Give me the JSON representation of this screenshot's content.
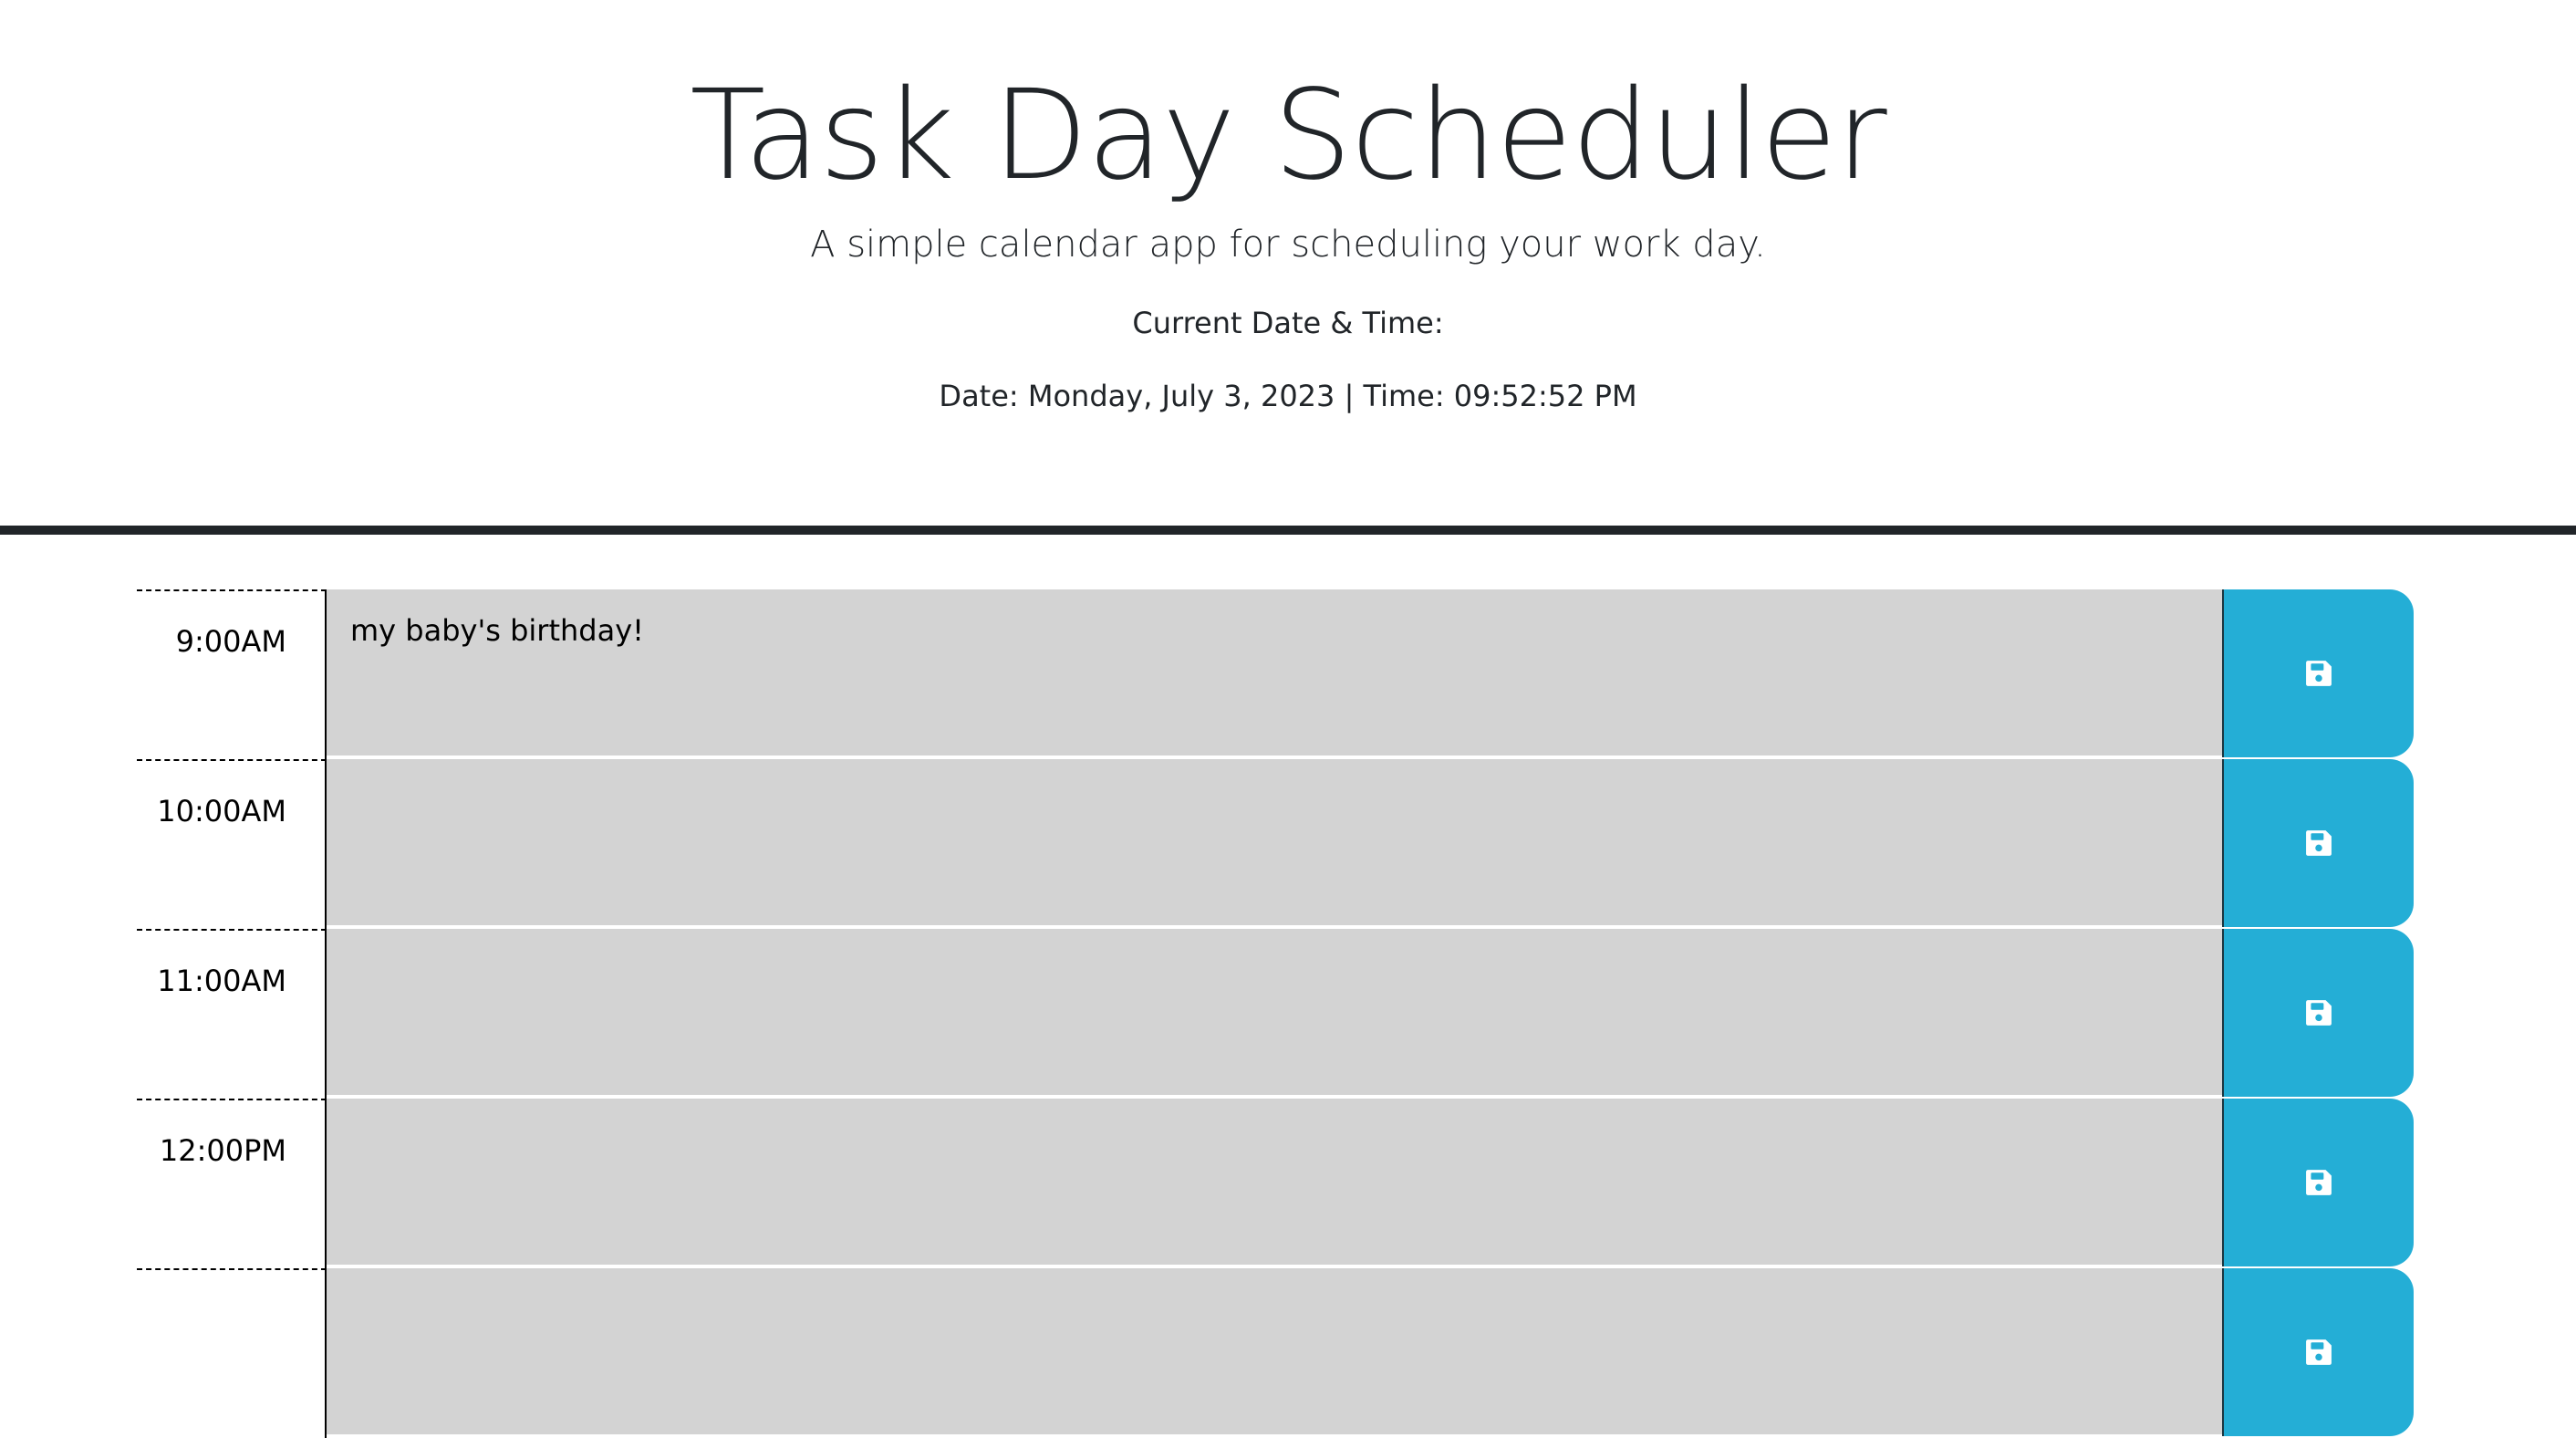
{
  "header": {
    "title": "Task Day Scheduler",
    "subtitle": "A simple calendar app for scheduling your work day.",
    "current_label": "Current Date & Time:",
    "current_value": "Date: Monday, July 3, 2023 | Time: 09:52:52 PM"
  },
  "rows": [
    {
      "hour": "9:00AM",
      "task": "my baby's birthday!"
    },
    {
      "hour": "10:00AM",
      "task": ""
    },
    {
      "hour": "11:00AM",
      "task": ""
    },
    {
      "hour": "12:00PM",
      "task": ""
    },
    {
      "hour": "",
      "task": ""
    }
  ],
  "icons": {
    "save": "floppy-disk-icon"
  },
  "colors": {
    "task_background": "#d3d3d3",
    "save_button": "#24aed6",
    "header_text": "#212529",
    "header_rule": "#212529"
  }
}
